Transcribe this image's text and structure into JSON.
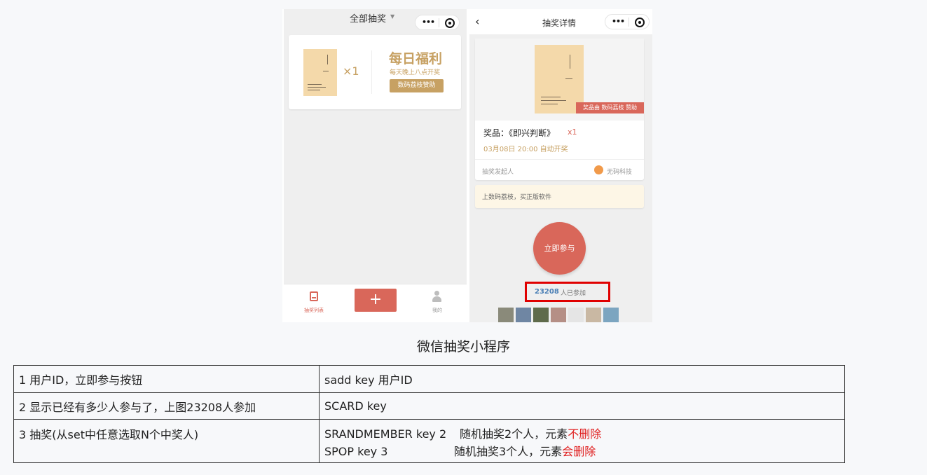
{
  "screenshot": {
    "left": {
      "title": "全部抽奖",
      "prize_multiplier": "×1",
      "promo_title": "每日福利",
      "promo_sub": "每天晚上八点开奖",
      "promo_btn": "数码荔枝赞助",
      "tab_list": "抽奖列表",
      "tab_add": "+",
      "tab_mine": "我的"
    },
    "right": {
      "title": "抽奖详情",
      "sponsor_badge": "奖品由 数码荔枝 赞助",
      "prize_label": "奖品：《即兴判断》",
      "prize_mult": "x1",
      "draw_time": "03月08日 20:00 自动开奖",
      "initiator_label": "抽奖发起人",
      "initiator_name": "无码科技",
      "notice": "上数码荔枝，买正版软件",
      "join_btn": "立即参与",
      "participants_count": "23208",
      "participants_suffix": "人已参加"
    },
    "colors": {
      "accent": "#d9675a",
      "gold": "#c7a163",
      "highlight": "#e00000"
    }
  },
  "caption": "微信抽奖小程序",
  "table": {
    "rows": [
      {
        "c1": "1 用户ID，立即参与按钮",
        "c2a": "sadd key 用户ID"
      },
      {
        "c1": "2 显示已经有多少人参与了，上图23208人参加",
        "c2a": "SCARD key"
      },
      {
        "c1": "3 抽奖(从set中任意选取N个中奖人)",
        "l1_cmd": "SRANDMEMBER key 2",
        "l1_desc": "随机抽奖2个人，元素",
        "l1_red": "不删除",
        "l2_cmd": "SPOP  key 3",
        "l2_desc": "随机抽奖3个人，元素",
        "l2_red": "会删除"
      }
    ]
  }
}
